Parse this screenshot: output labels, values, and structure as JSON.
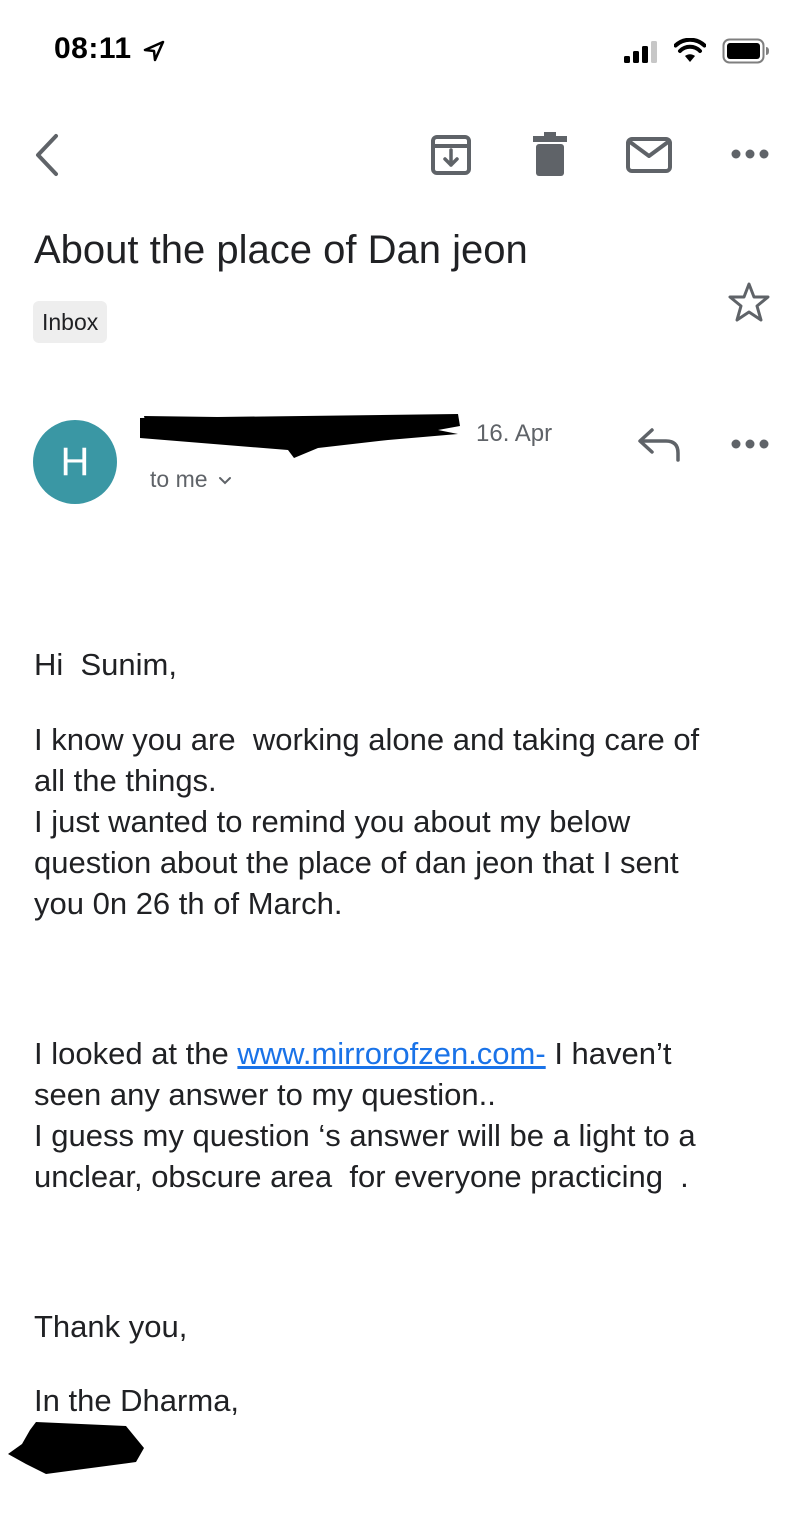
{
  "status_bar": {
    "time": "08:11",
    "location_icon": "location-arrow-icon",
    "signal_icon": "cellular-signal-icon",
    "wifi_icon": "wifi-icon",
    "battery_icon": "battery-icon"
  },
  "toolbar": {
    "back_icon": "chevron-left-icon",
    "archive_icon": "archive-icon",
    "delete_icon": "trash-icon",
    "mark_unread_icon": "mail-icon",
    "more_icon": "more-horizontal-icon"
  },
  "email": {
    "subject": "About the place of Dan jeon",
    "label": "Inbox",
    "star_icon": "star-outline-icon",
    "avatar_initial": "H",
    "avatar_color": "#3a97a4",
    "date": "16. Apr",
    "recipients": "to me",
    "reply_icon": "reply-icon",
    "body": {
      "greeting": "Hi  Sunim,",
      "p1_l1": "I know you are  working alone and taking care of",
      "p1_l2": "all the things.",
      "p1_l3": "I just wanted to remind you about my below",
      "p1_l4": "question about the place of dan jeon that I sent",
      "p1_l5": "you 0n 26 th of March.",
      "p2_l1_pre": "I looked at the ",
      "p2_link": "www.mirrorofzen.com-",
      "p2_l1_post": " I haven’t",
      "p2_l2": "seen any answer to my question..",
      "p2_l3": "I guess my question ‘s answer will be a light to a",
      "p2_l4": "unclear, obscure area  for everyone practicing  .",
      "closing": "Thank you,",
      "signoff": "In the Dharma,"
    }
  },
  "colors": {
    "link": "#1a73e8",
    "text_primary": "#202124",
    "text_secondary": "#5f6368",
    "chip_bg": "#eeeeee"
  }
}
